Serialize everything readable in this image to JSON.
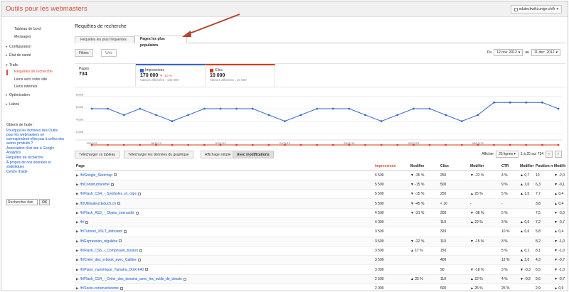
{
  "app": {
    "title": "Outils pour les webmasters",
    "site": "edutechwiki.unige.ch/fr"
  },
  "sidebar": {
    "items": [
      {
        "label": "Tableau de bord",
        "kind": "top"
      },
      {
        "label": "Messages",
        "kind": "top"
      },
      {
        "label": "Configuration",
        "kind": "sec"
      },
      {
        "label": "État de santé",
        "kind": "sec"
      },
      {
        "label": "Trafic",
        "kind": "sec-open"
      },
      {
        "label": "Requêtes de recherche",
        "kind": "sub-active"
      },
      {
        "label": "Liens vers votre site",
        "kind": "sub"
      },
      {
        "label": "Liens internes",
        "kind": "sub"
      },
      {
        "label": "Optimisation",
        "kind": "sec"
      },
      {
        "label": "Labos",
        "kind": "sec"
      }
    ],
    "help": {
      "title": "Obtenir de l'aide :",
      "links": [
        "Pourquoi les données des Outils pour les webmasters ne correspondent-elles pas à celles des autres produits ?",
        "Association d'un site à Google Analytics",
        "Requêtes de recherche",
        "À propos de nos données et statistiques",
        "Centre d'aide"
      ],
      "search_value": "Rechercher dan",
      "ok": "OK"
    }
  },
  "main": {
    "title": "Requêtes de recherche",
    "tabs": [
      "Requêtes les plus fréquentes",
      "Pages les plus populaires"
    ],
    "filters_btn": "Filtres",
    "web_btn": "Web",
    "date": {
      "du": "Du",
      "from": "12 nov. 2012",
      "au": "au",
      "to": "11 déc. 2012"
    },
    "summary": {
      "pages": {
        "label": "Pages",
        "value": "734"
      },
      "impressions": {
        "label": "Impressions",
        "value": "170 000",
        "change": "▼ -10 %",
        "sub": "Valeurs affichées : 140 000"
      },
      "clicks": {
        "label": "Clics",
        "value": "10 000",
        "sub": "Valeurs affichées : 10 000"
      }
    },
    "toolbar": {
      "download_table": "Télécharger ce tableau",
      "download_chart": "Télécharger les données du graphique",
      "simple": "Affichage simple",
      "with_changes": "Avec modifications",
      "show": "Afficher",
      "rows": "25 lignes",
      "range": "1 à 25 sur 734"
    },
    "colors": {
      "impressions": "#3366cc",
      "clicks": "#dc3912",
      "accent": "#dd4b39"
    }
  },
  "chart_data": {
    "type": "line",
    "x": [
      "12/11/12",
      "13/11/12",
      "14/11/12",
      "15/11/12",
      "16/11/12",
      "17/11/12",
      "18/11/12",
      "19/11/12",
      "20/11/12",
      "21/11/12",
      "22/11/12",
      "23/11/12",
      "24/11/12",
      "25/11/12",
      "26/11/12",
      "27/11/12",
      "28/11/12",
      "29/11/12",
      "30/11/12",
      "01/12/12",
      "02/12/12",
      "03/12/12",
      "04/12/12",
      "05/12/12",
      "06/12/12",
      "07/12/12",
      "08/12/12",
      "09/12/12",
      "10/12/12",
      "11/12/12"
    ],
    "x_tick_labels": [
      "12/11/12",
      "16/11/12",
      "20/11/12",
      "24/11/12",
      "28/11/12",
      "02/12/12",
      "06/12/12"
    ],
    "series": [
      {
        "name": "Impressions",
        "color": "#3366cc",
        "values": [
          6000,
          6000,
          5000,
          6000,
          5000,
          4000,
          5000,
          6000,
          6000,
          6000,
          6000,
          5000,
          4000,
          5000,
          6000,
          6000,
          6000,
          5000,
          4000,
          5000,
          6000,
          6000,
          5000,
          4000,
          5000,
          7000,
          7000,
          7000,
          7000,
          6000
        ]
      },
      {
        "name": "Clics",
        "color": "#dc3912",
        "values": [
          200,
          200,
          200,
          200,
          200,
          200,
          200,
          200,
          200,
          200,
          200,
          200,
          200,
          200,
          200,
          200,
          200,
          200,
          200,
          200,
          200,
          200,
          200,
          200,
          200,
          200,
          200,
          200,
          200,
          200
        ]
      }
    ],
    "y_ticks": [
      "8,000",
      "6,000",
      "4,000",
      "2,000"
    ],
    "ylim": [
      1000,
      8500
    ],
    "grid": true
  },
  "table": {
    "headers": [
      "Page",
      "Impressions",
      "Modifier",
      "Clics",
      "Modifier",
      "CTR",
      "Modifier",
      "Position moy.",
      "Modifier"
    ],
    "rows": [
      {
        "page": "/fr/Google_Sketchup",
        "imp": "6 500",
        "impc": "-35 %",
        "impd": "dn",
        "cl": "250",
        "clc": "-22 %",
        "cld": "dn",
        "ctr": "4 %",
        "ctrc": "0,7",
        "ctrd": "up",
        "pos": "10",
        "posc": "-2,0",
        "posd": "dn"
      },
      {
        "page": "/fr/Constructivisme",
        "imp": "5 500",
        "impc": "-15 %",
        "impd": "dn",
        "cl": "500",
        "clc": "",
        "cld": "",
        "ctr": "9 %",
        "ctrc": "2,0",
        "ctrd": "up",
        "pos": "6,3",
        "posc": "-0,1",
        "posd": "dn"
      },
      {
        "page": "/fr/Flash_CS4_-_Symboles_et_clips",
        "imp": "5 500",
        "impc": "-15 %",
        "impd": "dn",
        "cl": "250",
        "clc": "25 %",
        "cld": "up",
        "ctr": "5 %",
        "ctrc": "1,0",
        "ctrd": "up",
        "pos": "7,7",
        "posc": "0,4",
        "posd": "up"
      },
      {
        "page": "/fr/Utilisateur:Educh.ch",
        "imp": "5 500",
        "impc": "-45 %",
        "impd": "dn",
        "cl": "< 10",
        "clc": "-",
        "cld": "grey",
        "ctr": "-",
        "ctrc": "",
        "ctrd": "",
        "pos": "3,8",
        "posc": "0,4",
        "posd": "up"
      },
      {
        "page": "/fr/Flash_AS3_-_Objets_interactifs",
        "imp": "4 500",
        "impc": "-31 %",
        "impd": "dn",
        "cl": "200",
        "clc": "-38 %",
        "cld": "dn",
        "ctr": "5 %",
        "ctrc": "",
        "ctrd": "",
        "pos": "7,5",
        "posc": "-3,0",
        "posd": "dn"
      },
      {
        "page": "/fr/",
        "imp": "4 000",
        "impc": "",
        "impd": "",
        "cl": "110",
        "clc": "22 %",
        "cld": "up",
        "ctr": "3 %",
        "ctrc": "0,6",
        "ctrd": "up",
        "pos": "7,2",
        "posc": "-0,7",
        "posd": "dn"
      },
      {
        "page": "/fr/Tutoriel_XSLT_débutant",
        "imp": "3 500",
        "impc": "",
        "impd": "",
        "cl": "320",
        "clc": "",
        "cld": "",
        "ctr": "10 %",
        "ctrc": "0,6",
        "ctrd": "up",
        "pos": "5,8",
        "posc": "0,4",
        "posd": "up"
      },
      {
        "page": "/fr/Expression_régulière",
        "imp": "3 500",
        "impc": "-22 %",
        "impd": "dn",
        "cl": "110",
        "clc": "-15 %",
        "cld": "dn",
        "ctr": "3 %",
        "ctrc": "",
        "ctrd": "",
        "pos": "8,2",
        "posc": "-1,0",
        "posd": "dn"
      },
      {
        "page": "/fr/Flash_CS5_-_Composant_bouton",
        "imp": "3 500",
        "impc": "17 %",
        "impd": "up",
        "cl": "150",
        "clc": "",
        "cld": "",
        "ctr": "5 %",
        "ctrc": "0,1",
        "ctrd": "up",
        "pos": "8,1",
        "posc": "-1,0",
        "posd": "dn"
      },
      {
        "page": "/fr/Créer_des_e-book_avec_Calibre",
        "imp": "3 500",
        "impc": "",
        "impd": "",
        "cl": "400",
        "clc": "",
        "cld": "",
        "ctr": "12 %",
        "ctrc": "2,0",
        "ctrd": "up",
        "pos": "4,3",
        "posc": "-0,7",
        "posd": "dn"
      },
      {
        "page": "/fr/Piano_numérique_Yamaha_DGX-640",
        "imp": "3 000",
        "impc": "",
        "impd": "",
        "cl": "90",
        "clc": "-18 %",
        "cld": "dn",
        "ctr": "3 %",
        "ctrc": "-0,3",
        "ctrd": "dn",
        "pos": "6,5",
        "posc": "-1,0",
        "posd": "dn"
      },
      {
        "page": "/fr/Flash_CS4_-_Créer_des_dessins_avec_les_outils_de_dessin",
        "imp": "2 500",
        "impc": "25 %",
        "impd": "up",
        "cl": "110",
        "clc": "22 %",
        "cld": "up",
        "ctr": "4 %",
        "ctrc": "-0,2",
        "ctrd": "dn",
        "pos": "9,6",
        "posc": "-0,7",
        "posd": "dn"
      },
      {
        "page": "/fr/Socio-constructivisme",
        "imp": "2 000",
        "impc": "",
        "impd": "",
        "cl": "500",
        "clc": "25 %",
        "cld": "up",
        "ctr": "25 %",
        "ctrc": "",
        "ctrd": "",
        "pos": "2,9",
        "posc": "0,9",
        "posd": "up"
      }
    ]
  }
}
